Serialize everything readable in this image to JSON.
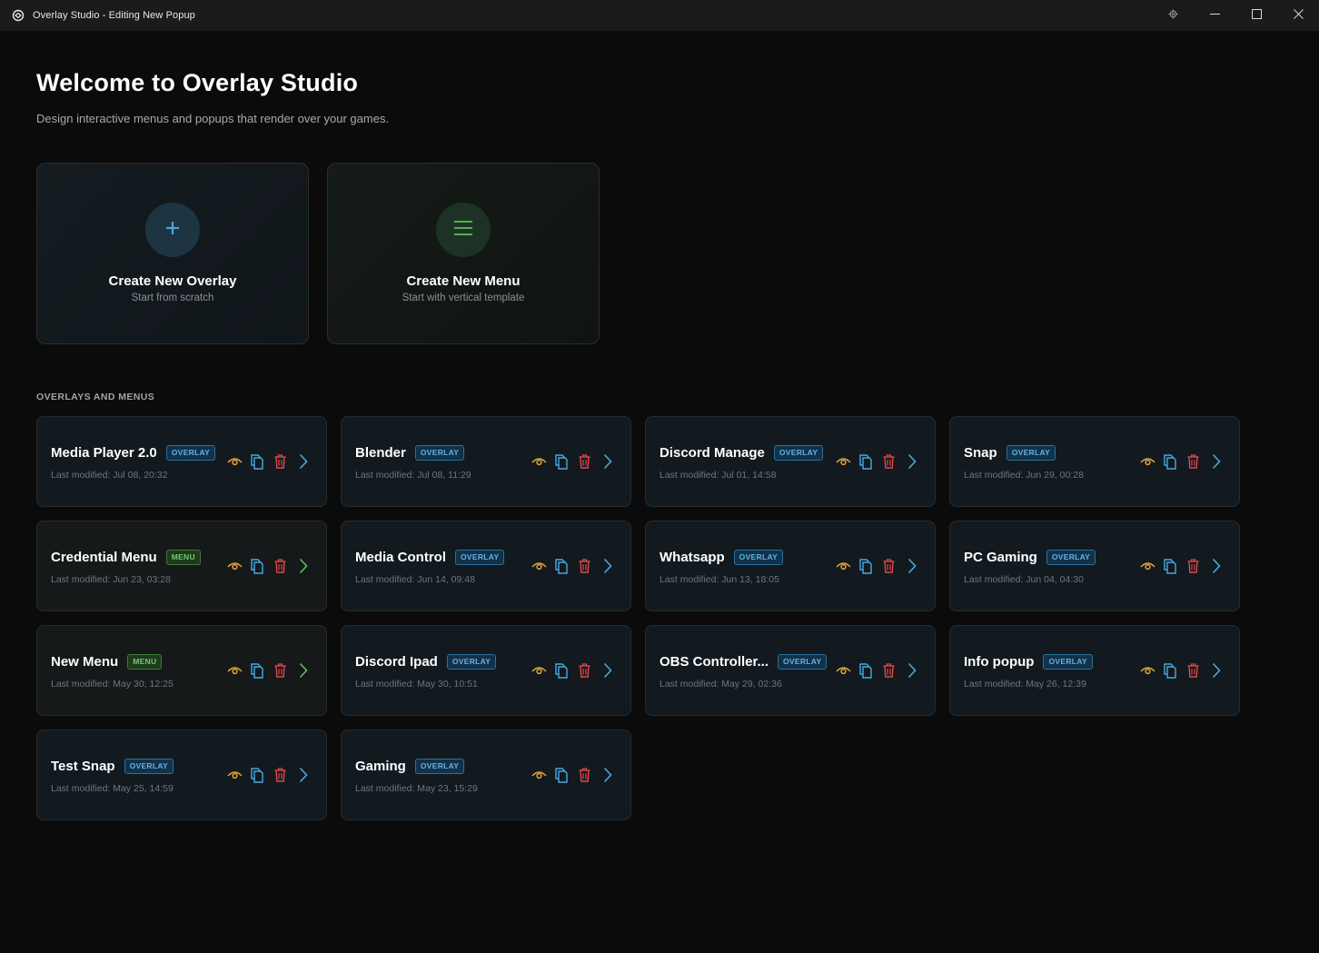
{
  "window": {
    "title": "Overlay Studio - Editing New Popup"
  },
  "header": {
    "title": "Welcome to Overlay Studio",
    "subtitle": "Design interactive menus and popups that render over your games."
  },
  "create": {
    "overlay": {
      "title": "Create New Overlay",
      "subtitle": "Start from scratch",
      "icon": "plus-icon"
    },
    "menu": {
      "title": "Create New Menu",
      "subtitle": "Start with vertical template",
      "icon": "menu-lines-icon"
    }
  },
  "section_label": "OVERLAYS AND MENUS",
  "colors": {
    "overlay_accent": "#4aa8e0",
    "menu_accent": "#5cbf5a",
    "preview_icon": "#e3a437",
    "delete_icon": "#e0474b"
  },
  "items": [
    {
      "name": "Media Player 2.0",
      "type": "OVERLAY",
      "modified": "Last modified: Jul 08, 20:32"
    },
    {
      "name": "Blender",
      "type": "OVERLAY",
      "modified": "Last modified: Jul 08, 11:29"
    },
    {
      "name": "Discord Manage",
      "type": "OVERLAY",
      "modified": "Last modified: Jul 01, 14:58"
    },
    {
      "name": "Snap",
      "type": "OVERLAY",
      "modified": "Last modified: Jun 29, 00:28"
    },
    {
      "name": "Credential Menu",
      "type": "MENU",
      "modified": "Last modified: Jun 23, 03:28"
    },
    {
      "name": "Media Control",
      "type": "OVERLAY",
      "modified": "Last modified: Jun 14, 09:48"
    },
    {
      "name": "Whatsapp",
      "type": "OVERLAY",
      "modified": "Last modified: Jun 13, 18:05"
    },
    {
      "name": "PC Gaming",
      "type": "OVERLAY",
      "modified": "Last modified: Jun 04, 04:30"
    },
    {
      "name": "New Menu",
      "type": "MENU",
      "modified": "Last modified: May 30, 12:25"
    },
    {
      "name": "Discord Ipad",
      "type": "OVERLAY",
      "modified": "Last modified: May 30, 10:51"
    },
    {
      "name": "OBS Controller...",
      "type": "OVERLAY",
      "modified": "Last modified: May 29, 02:36"
    },
    {
      "name": "Info popup",
      "type": "OVERLAY",
      "modified": "Last modified: May 26, 12:39"
    },
    {
      "name": "Test Snap",
      "type": "OVERLAY",
      "modified": "Last modified: May 25, 14:59"
    },
    {
      "name": "Gaming",
      "type": "OVERLAY",
      "modified": "Last modified: May 23, 15:29"
    }
  ]
}
